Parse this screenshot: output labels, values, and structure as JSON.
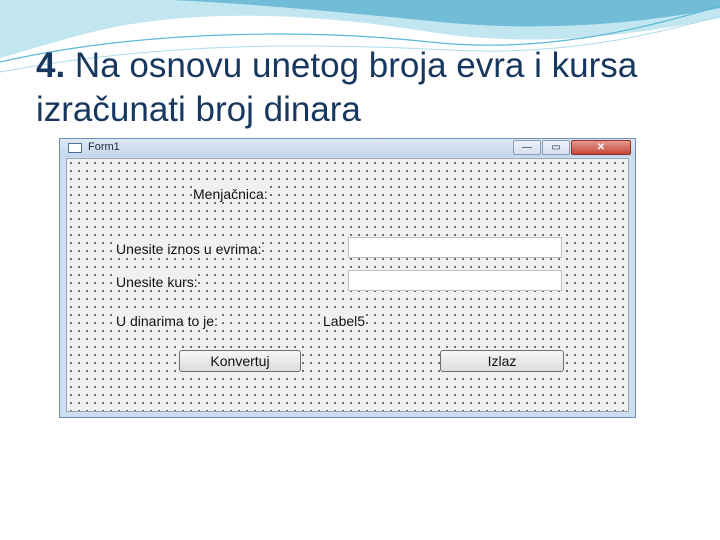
{
  "slide": {
    "title_number": "4.",
    "title_text": " Na osnovu unetog broja evra i kursa izračunati broj dinara"
  },
  "window": {
    "title": "Form1",
    "minimize_glyph": "—",
    "maximize_glyph": "▭",
    "close_glyph": "✕"
  },
  "form": {
    "heading": "Menjačnica:",
    "euro_label": "Unesite iznos u evrima:",
    "euro_value": "",
    "rate_label": "Unesite kurs:",
    "rate_value": "",
    "result_label": "U dinarima to je:",
    "result_value": "Label5",
    "convert_button": "Konvertuj",
    "exit_button": "Izlaz"
  },
  "colors": {
    "title_text": "#17375e",
    "titlebar": "#c4d6ec",
    "form_background": "#f0f0f0"
  }
}
